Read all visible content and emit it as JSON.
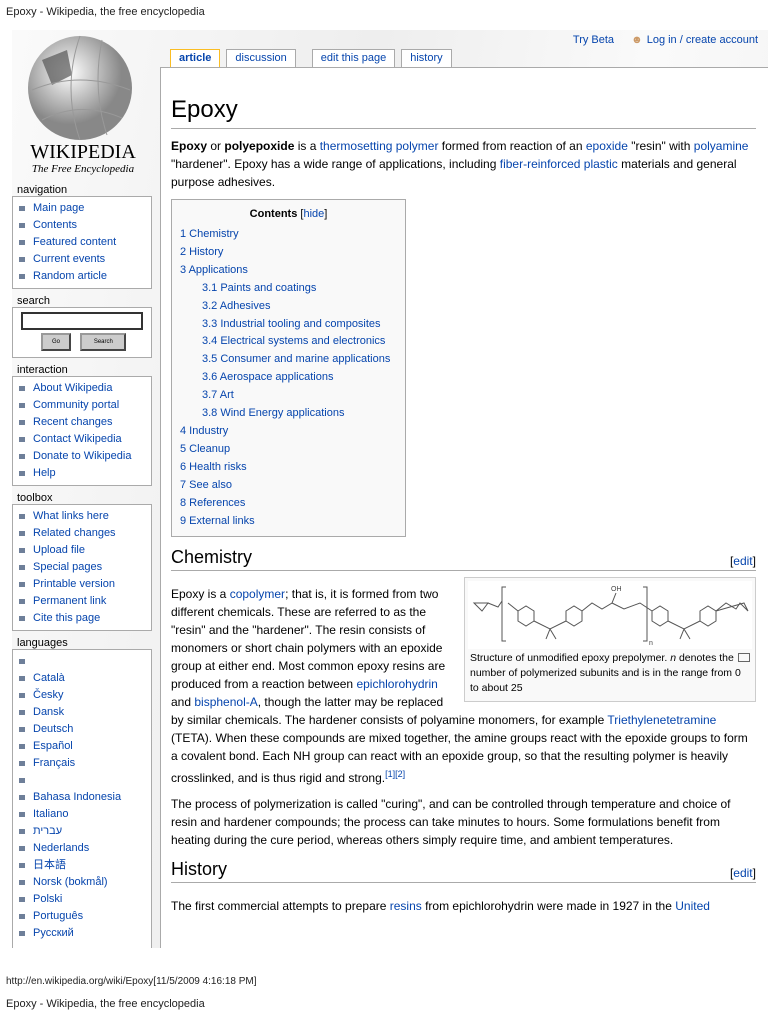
{
  "page_title": "Epoxy - Wikipedia, the free encyclopedia",
  "logo": {
    "wordmark": "WIKIPEDIA",
    "tagline": "The Free Encyclopedia"
  },
  "personal": {
    "try_beta": "Try Beta",
    "login": "Log in / create account"
  },
  "tabs": [
    "article",
    "discussion",
    "edit this page",
    "history"
  ],
  "article": {
    "title": "Epoxy",
    "intro": {
      "b1": "Epoxy",
      "t1": " or ",
      "b2": "polyepoxide",
      "t2": " is a ",
      "l1": "thermosetting polymer",
      "t3": " formed from reaction of an ",
      "l2": "epoxide",
      "t4": " \"resin\" with ",
      "l3": "polyamine",
      "t5": " \"hardener\". Epoxy has a wide range of applications, including ",
      "l4": "fiber-reinforced plastic",
      "t6": " materials and general purpose adhesives."
    },
    "toc": {
      "title": "Contents",
      "hide": "hide",
      "items": [
        {
          "t": "1 Chemistry",
          "l": 1
        },
        {
          "t": "2 History",
          "l": 1
        },
        {
          "t": "3 Applications",
          "l": 1
        },
        {
          "t": "3.1 Paints and coatings",
          "l": 2
        },
        {
          "t": "3.2 Adhesives",
          "l": 2
        },
        {
          "t": "3.3 Industrial tooling and composites",
          "l": 2
        },
        {
          "t": "3.4 Electrical systems and electronics",
          "l": 2
        },
        {
          "t": "3.5 Consumer and marine applications",
          "l": 2
        },
        {
          "t": "3.6 Aerospace applications",
          "l": 2
        },
        {
          "t": "3.7 Art",
          "l": 2
        },
        {
          "t": "3.8 Wind Energy applications",
          "l": 2
        },
        {
          "t": "4 Industry",
          "l": 1
        },
        {
          "t": "5 Cleanup",
          "l": 1
        },
        {
          "t": "6 Health risks",
          "l": 1
        },
        {
          "t": "7 See also",
          "l": 1
        },
        {
          "t": "8 References",
          "l": 1
        },
        {
          "t": "9 External links",
          "l": 1
        }
      ]
    },
    "edit_label": "edit",
    "chemistry": {
      "heading": "Chemistry",
      "p1": {
        "t1": "Epoxy is a ",
        "l1": "copolymer",
        "t2": "; that is, it is formed from two different chemicals. These are referred to as the \"resin\" and the \"hardener\". The resin consists of monomers or short chain polymers with an epoxide group at either end. Most common epoxy resins are produced from a reaction between ",
        "l2": "epichlorohydrin",
        "t3": " and ",
        "l3": "bisphenol-A",
        "t4": ", though the latter may be replaced by similar chemicals. The hardener consists of polyamine monomers, for example ",
        "l4": "Triethylenetetramine",
        "t5": " (TETA). When these compounds are mixed together, the amine groups react with the epoxide groups to form a covalent bond. Each NH group can react with an epoxide group, so that the resulting polymer is heavily crosslinked, and is thus rigid and strong.",
        "r1": "[1]",
        "r2": "[2]"
      },
      "p2": "The process of polymerization is called \"curing\", and can be controlled through temperature and choice of resin and hardener compounds; the process can take minutes to hours. Some formulations benefit from heating during the cure period, whereas others simply require time, and ambient temperatures.",
      "figure": {
        "oh": "OH",
        "n": "n",
        "cap1": "Structure of unmodified epoxy prepolymer. ",
        "cap_n": "n",
        "cap2": " denotes the number of polymerized subunits and is in the range from 0 to about 25"
      }
    },
    "history": {
      "heading": "History",
      "t1": "The first commercial attempts to prepare ",
      "l1": "resins",
      "t2": " from epichlorohydrin were made in 1927 in the ",
      "l2": "United"
    }
  },
  "sidebar": {
    "navigation": {
      "title": "navigation",
      "items": [
        "Main page",
        "Contents",
        "Featured content",
        "Current events",
        "Random article"
      ]
    },
    "search": {
      "title": "search",
      "go": "Go",
      "search": "Search"
    },
    "interaction": {
      "title": "interaction",
      "items": [
        "About Wikipedia",
        "Community portal",
        "Recent changes",
        "Contact Wikipedia",
        "Donate to Wikipedia",
        "Help"
      ]
    },
    "toolbox": {
      "title": "toolbox",
      "items": [
        "What links here",
        "Related changes",
        "Upload file",
        "Special pages",
        "Printable version",
        "Permanent link",
        "Cite this page"
      ]
    },
    "languages": {
      "title": "languages",
      "items": [
        "",
        "Català",
        "Česky",
        "Dansk",
        "Deutsch",
        "Español",
        "Français",
        "",
        "Bahasa Indonesia",
        "Italiano",
        "עברית",
        "Nederlands",
        "日本語",
        "Norsk (bokmål)",
        "Polski",
        "Português",
        "Русский"
      ]
    }
  },
  "footer": {
    "url": "http://en.wikipedia.org/wiki/Epoxy[11/5/2009 4:16:18 PM]",
    "title": "Epoxy - Wikipedia, the free encyclopedia"
  }
}
